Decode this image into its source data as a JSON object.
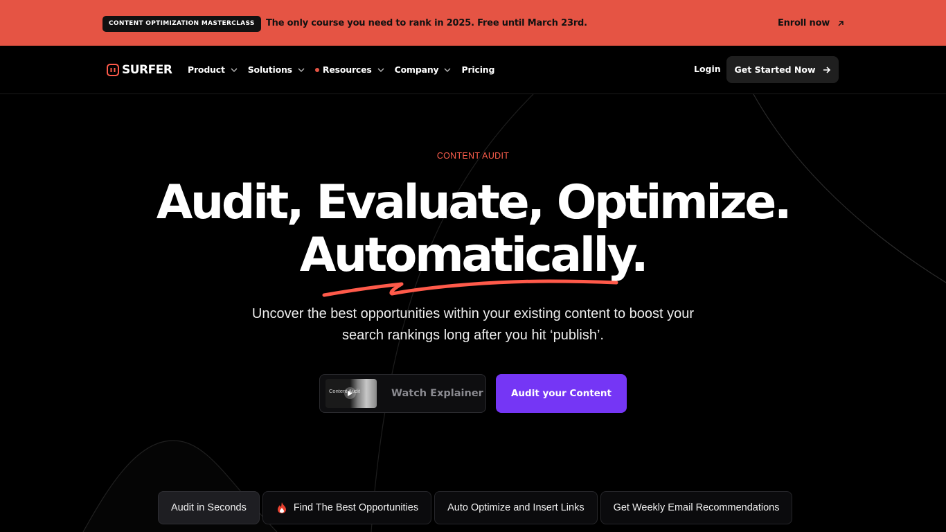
{
  "banner": {
    "badge": "CONTENT OPTIMIZATION MASTERCLASS",
    "message": "The only course you need to rank in 2025. Free until March 23rd.",
    "enroll_label": "Enroll now",
    "background": "#e55444"
  },
  "nav": {
    "logo_text": "SURFER",
    "items": [
      {
        "label": "Product",
        "icon": "chevron-down-icon"
      },
      {
        "label": "Solutions",
        "icon": "chevron-down-icon"
      },
      {
        "label": "Resources",
        "icon": "chevron-down-icon",
        "badge_dot": true
      },
      {
        "label": "Company",
        "icon": "chevron-down-icon"
      },
      {
        "label": "Pricing"
      }
    ],
    "login_label": "Login",
    "cta_label": "Get Started Now"
  },
  "hero": {
    "eyebrow": "CONTENT AUDIT",
    "headline_line1": "Audit, Evaluate, Optimize.",
    "headline_line2": "Automatically.",
    "subtext": "Uncover the best opportunities within your existing content to boost your search rankings long after you hit ‘publish’.",
    "watch_label": "Watch Explainer",
    "thumb_text": "Content Audit",
    "primary_cta": "Audit your Content",
    "accent_color": "#7536f5",
    "underline_color": "#ff5a4a"
  },
  "tabs": [
    {
      "label": "Audit in Seconds",
      "active": true
    },
    {
      "label": "Find The Best Opportunities",
      "icon": "fire-icon"
    },
    {
      "label": "Auto Optimize and Insert Links"
    },
    {
      "label": "Get Weekly Email Recommendations"
    }
  ]
}
